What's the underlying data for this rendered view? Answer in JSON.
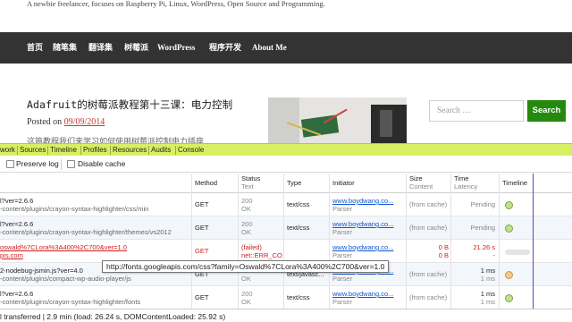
{
  "site": {
    "tagline": "A newbie freelancer, focuses on Raspberry Pi, Linux, WordPress, Open Source and Programming."
  },
  "nav": {
    "items": [
      {
        "label": "首页"
      },
      {
        "label": "随笔集"
      },
      {
        "label": "翻译集"
      },
      {
        "label": "树莓派"
      },
      {
        "label": "WordPress"
      },
      {
        "label": "程序开发"
      },
      {
        "label": "About Me"
      }
    ]
  },
  "post": {
    "title": "Adafruit的树莓派教程第十三课：电力控制",
    "posted_label": "Posted on",
    "date": "09/09/2014",
    "text_peek": "这篇教程我们来学习如何使用树莓派控制电力插座"
  },
  "search": {
    "placeholder": "Search …",
    "button_label": "Search"
  },
  "devtools": {
    "tabs": [
      "work",
      "Sources",
      "Timeline",
      "Profiles",
      "Resources",
      "Audits",
      "Console"
    ],
    "preserve_log_label": "Preserve log",
    "disable_cache_label": "Disable cache",
    "columns": {
      "method": "Method",
      "status": "Status",
      "status_sub": "Text",
      "type": "Type",
      "initiator": "Initiator",
      "size": "Size",
      "size_sub": "Content",
      "time": "Time",
      "time_sub": "Latency",
      "timeline": "Timeline"
    },
    "rows": [
      {
        "name": "l?ver=2.6.6",
        "path": "-content/plugins/crayon-syntax-highlighter/css/min",
        "method": "GET",
        "status": "200",
        "status_text": "OK",
        "type": "text/css",
        "initiator": "www.boydwang.co...",
        "initiator_sub": "Parser",
        "size": "(from cache)",
        "size_sub": "",
        "time": "Pending",
        "time_sub": "",
        "failed": false
      },
      {
        "name": "l?ver=2.6.6",
        "path": "-content/plugins/crayon-syntax-highlighter/themes/vs2012",
        "method": "GET",
        "status": "200",
        "status_text": "OK",
        "type": "text/css",
        "initiator": "www.boydwang.co...",
        "initiator_sub": "Parser",
        "size": "(from cache)",
        "size_sub": "",
        "time": "Pending",
        "time_sub": "",
        "failed": false
      },
      {
        "name": "oswald%7CLora%3A400%2C700&ver=1.0",
        "path": "pis.com",
        "method": "GET",
        "status": "(failed)",
        "status_text": "net::ERR_CO",
        "type": "",
        "initiator": "www.boydwang.co...",
        "initiator_sub": "Parser",
        "size": "0 B",
        "size_sub": "0 B",
        "time": "21.26 s",
        "time_sub": "-",
        "failed": true
      },
      {
        "name": "2-nodebug-jsmin.js?ver=4.0",
        "path": "-content/plugins/compact-wp-audio-player/js",
        "method": "GET",
        "status": "200",
        "status_text": "OK",
        "type": "text/javasc...",
        "initiator": "www.boydwang.co...",
        "initiator_sub": "Parser",
        "size": "(from cache)",
        "size_sub": "",
        "time": "1 ms",
        "time_sub": "1 ms",
        "failed": false
      },
      {
        "name": "l?ver=2.6.6",
        "path": "-content/plugins/crayon-syntax-highlighter/fonts",
        "method": "GET",
        "status": "200",
        "status_text": "OK",
        "type": "text/css",
        "initiator": "www.boydwang.co...",
        "initiator_sub": "Parser",
        "size": "(from cache)",
        "size_sub": "",
        "time": "1 ms",
        "time_sub": "1 ms",
        "failed": false
      }
    ],
    "tooltip": "http://fonts.googleapis.com/css?family=Oswald%7CLora%3A400%2C700&ver=1.0",
    "status_bar": "l transferred  |  2.9 min (load: 26.24 s, DOMContentLoaded: 25.92 s)"
  }
}
